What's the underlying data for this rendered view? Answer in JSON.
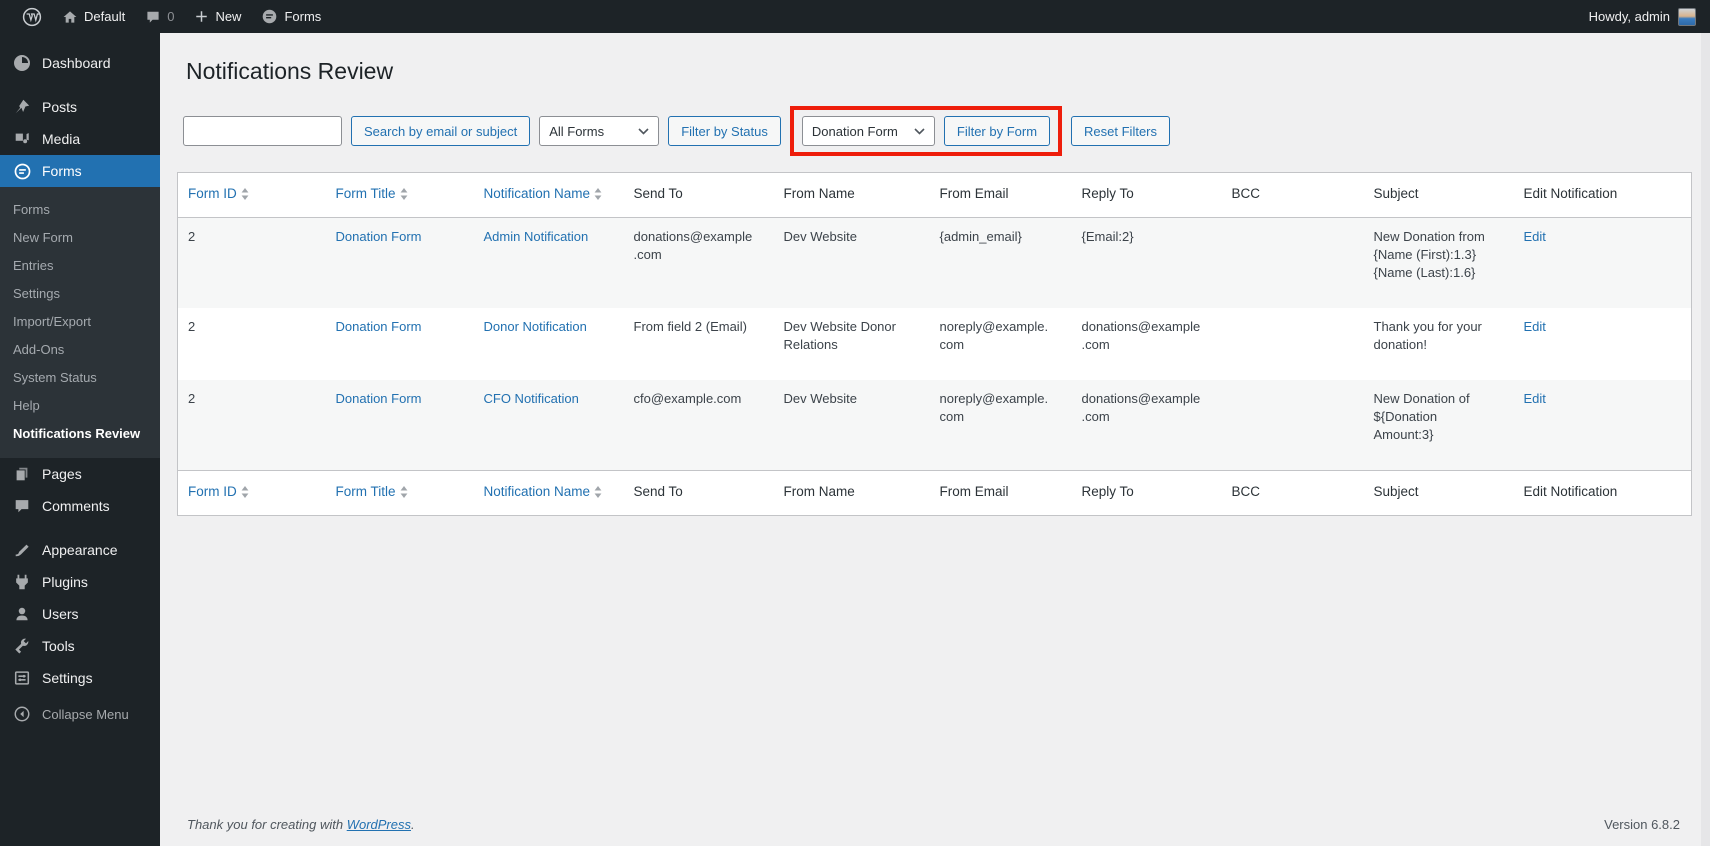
{
  "admin_bar": {
    "site_name": "Default",
    "comments_count": "0",
    "new_label": "New",
    "forms_label": "Forms",
    "howdy": "Howdy, admin"
  },
  "sidebar": {
    "dashboard": "Dashboard",
    "posts": "Posts",
    "media": "Media",
    "forms": "Forms",
    "forms_submenu": {
      "forms": "Forms",
      "new_form": "New Form",
      "entries": "Entries",
      "settings": "Settings",
      "import_export": "Import/Export",
      "addons": "Add-Ons",
      "system_status": "System Status",
      "help": "Help",
      "notifications_review": "Notifications Review"
    },
    "pages": "Pages",
    "comments": "Comments",
    "appearance": "Appearance",
    "plugins": "Plugins",
    "users": "Users",
    "tools": "Tools",
    "settings": "Settings",
    "collapse_menu": "Collapse Menu"
  },
  "page": {
    "title": "Notifications Review",
    "filters": {
      "search_value": "",
      "search_button": "Search by email or subject",
      "all_forms_select": "All Forms",
      "filter_status_button": "Filter by Status",
      "form_select": "Donation Form",
      "filter_form_button": "Filter by Form",
      "reset_button": "Reset Filters"
    }
  },
  "table": {
    "headers": [
      {
        "label": "Form ID",
        "sortable": true
      },
      {
        "label": "Form Title",
        "sortable": true
      },
      {
        "label": "Notification Name",
        "sortable": true
      },
      {
        "label": "Send To",
        "sortable": false
      },
      {
        "label": "From Name",
        "sortable": false
      },
      {
        "label": "From Email",
        "sortable": false
      },
      {
        "label": "Reply To",
        "sortable": false
      },
      {
        "label": "BCC",
        "sortable": false
      },
      {
        "label": "Subject",
        "sortable": false
      },
      {
        "label": "Edit Notification",
        "sortable": false
      }
    ],
    "rows": [
      {
        "form_id": "2",
        "form_title": "Donation Form",
        "notification_name": "Admin Notification",
        "send_to": "donations@example.com",
        "from_name": "Dev Website",
        "from_email": "{admin_email}",
        "reply_to": "{Email:2}",
        "bcc": "",
        "subject": "New Donation from {Name (First):1.3} {Name (Last):1.6}",
        "edit": "Edit"
      },
      {
        "form_id": "2",
        "form_title": "Donation Form",
        "notification_name": "Donor Notification",
        "send_to": "From field 2 (Email)",
        "from_name": "Dev Website Donor Relations",
        "from_email": "noreply@example.com",
        "reply_to": "donations@example.com",
        "bcc": "",
        "subject": "Thank you for your donation!",
        "edit": "Edit"
      },
      {
        "form_id": "2",
        "form_title": "Donation Form",
        "notification_name": "CFO Notification",
        "send_to": "cfo@example.com",
        "from_name": "Dev Website",
        "from_email": "noreply@example.com",
        "reply_to": "donations@example.com",
        "bcc": "",
        "subject": "New Donation of ${Donation Amount:3}",
        "edit": "Edit"
      }
    ]
  },
  "footer": {
    "thanks_prefix": "Thank you for creating with ",
    "wordpress_link": "WordPress",
    "thanks_suffix": ".",
    "version": "Version 6.8.2"
  },
  "colors": {
    "admin_dark": "#1d2327",
    "submenu_bg": "#2c3338",
    "active_blue": "#2271b1",
    "content_bg": "#f0f0f1",
    "table_border": "#c3c4c7",
    "alt_row": "#f6f7f7",
    "highlight_red": "#ee1d0b"
  }
}
